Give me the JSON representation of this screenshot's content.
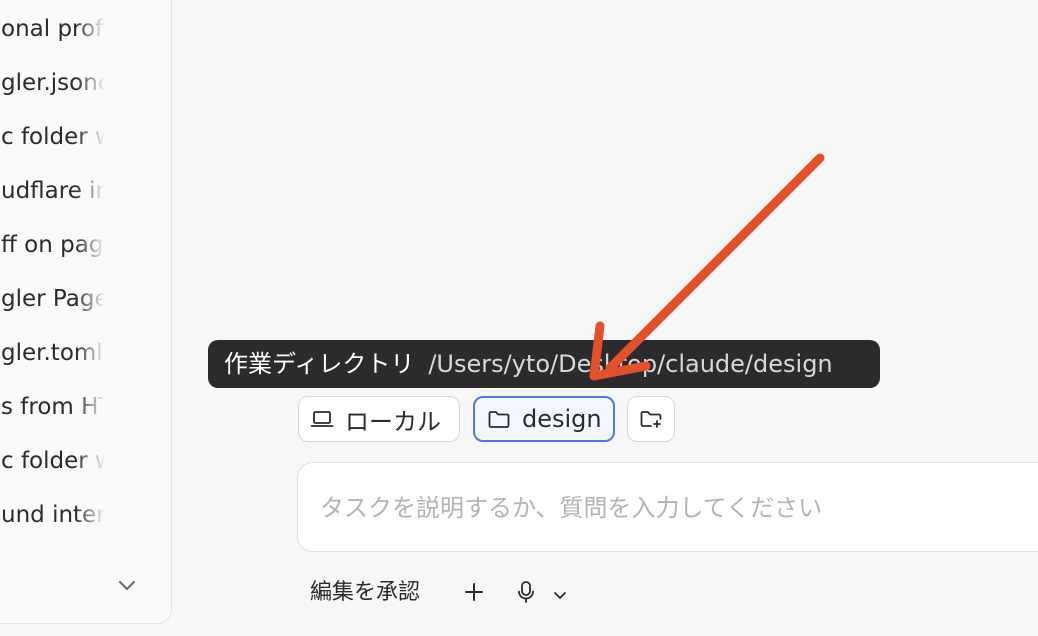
{
  "sidebar": {
    "items": [
      {
        "label": "onal profile"
      },
      {
        "label": "gler.jsonc c"
      },
      {
        "label": "c folder wi"
      },
      {
        "label": "udflare inte"
      },
      {
        "label": "ff on page"
      },
      {
        "label": "gler Pages"
      },
      {
        "label": "gler.toml c"
      },
      {
        "label": "s from HTM"
      },
      {
        "label": "c folder wi"
      },
      {
        "label": "und intere"
      }
    ],
    "expand_icon": "chevron-down-icon"
  },
  "tooltip": {
    "label": "作業ディレクトリ",
    "path": "/Users/yto/Desktop/claude/design"
  },
  "chips": {
    "local": {
      "label": "ローカル",
      "icon": "laptop-icon"
    },
    "folder": {
      "label": "design",
      "icon": "folder-icon",
      "selected": true
    },
    "add_folder": {
      "icon": "folder-plus-icon"
    }
  },
  "input": {
    "placeholder": "タスクを説明するか、質問を入力してください",
    "value": ""
  },
  "toolbar": {
    "approve_label": "編集を承認",
    "plus_icon": "plus-icon",
    "mic_icon": "mic-icon",
    "mic_menu_icon": "chevron-down-icon"
  },
  "colors": {
    "accent_border": "#4d7bd6",
    "tooltip_bg": "#2b2b2d",
    "arrow": "#e4502a"
  }
}
